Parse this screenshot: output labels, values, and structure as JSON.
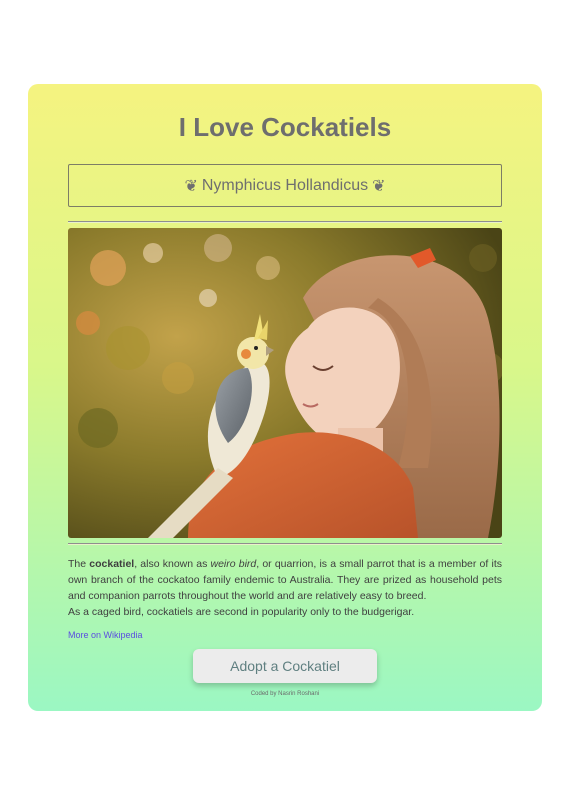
{
  "header": {
    "title": "I Love Cockatiels",
    "subtitle": "Nymphicus Hollandicus",
    "subtitle_icon_left": "leaf-icon",
    "subtitle_icon_right": "leaf-icon",
    "subtitle_glyph": "❦"
  },
  "photo": {
    "subject": "photo-girl-with-cockatiel"
  },
  "description": {
    "intro": "The ",
    "bold_term": "cockatiel",
    "mid1": ", also known as ",
    "italic_term": "weiro bird",
    "mid2": ", or quarrion, is a small parrot that is a member of its own branch of the cockatoo family endemic to Australia. They are prized as household pets and companion parrots throughout the world and are relatively easy to breed.",
    "second_line": "As a caged bird, cockatiels are second in popularity only to the budgerigar."
  },
  "links": {
    "wiki_label": "More on Wikipedia"
  },
  "actions": {
    "adopt_label": "Adopt a Cockatiel"
  },
  "footer": {
    "credit": "Coded by Nasrin Roshani"
  },
  "colors": {
    "gradient_top": "#f5f380",
    "gradient_bottom": "#9bf7c3",
    "title": "#6e6e6e",
    "link": "#5b4de0",
    "button_text": "#5f7f80"
  }
}
